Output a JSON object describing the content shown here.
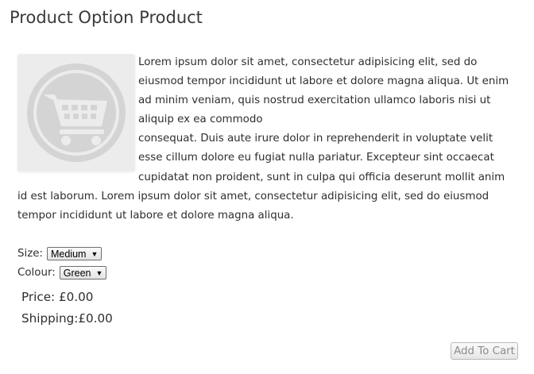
{
  "product": {
    "title": "Product Option Product",
    "image_icon": "shopping-cart-placeholder-icon",
    "description_p1": "Lorem ipsum dolor sit amet, consectetur adipisicing elit, sed do eiusmod tempor incididunt ut labore et dolore magna aliqua. Ut enim ad minim veniam, quis nostrud exercitation ullamco laboris nisi ut aliquip ex ea commodo",
    "description_p2": "consequat. Duis aute irure dolor in reprehenderit in voluptate velit esse cillum dolore eu fugiat nulla pariatur. Excepteur sint occaecat cupidatat non proident, sunt in culpa qui officia deserunt mollit anim id est laborum. Lorem ipsum dolor sit amet, consectetur adipisicing elit, sed do eiusmod tempor incididunt ut labore et dolore magna aliqua."
  },
  "options": {
    "size": {
      "label": "Size:",
      "selected": "Medium"
    },
    "colour": {
      "label": "Colour:",
      "selected": "Green"
    }
  },
  "pricing": {
    "price": "Price: £0.00",
    "shipping": "Shipping:£0.00"
  },
  "actions": {
    "add_to_cart_label": "Add To Cart"
  },
  "colors": {
    "image_placeholder_bg": "#ececec",
    "image_placeholder_icon": "#d4d4d4",
    "disabled_button_text": "#8c8c8c"
  }
}
